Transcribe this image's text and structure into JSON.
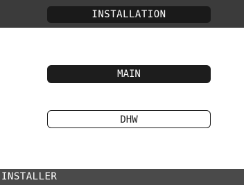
{
  "header": {
    "title": "INSTALLATION"
  },
  "menu": {
    "items": [
      {
        "label": "MAIN",
        "selected": true
      },
      {
        "label": "DHW",
        "selected": false
      }
    ]
  },
  "footer": {
    "label": "INSTALLER"
  },
  "colors": {
    "header_bg": "#3b3b3b",
    "title_bg": "#1a1a1a",
    "selected_bg": "#1d1d1d",
    "footer_bg": "#4a4a4a"
  }
}
